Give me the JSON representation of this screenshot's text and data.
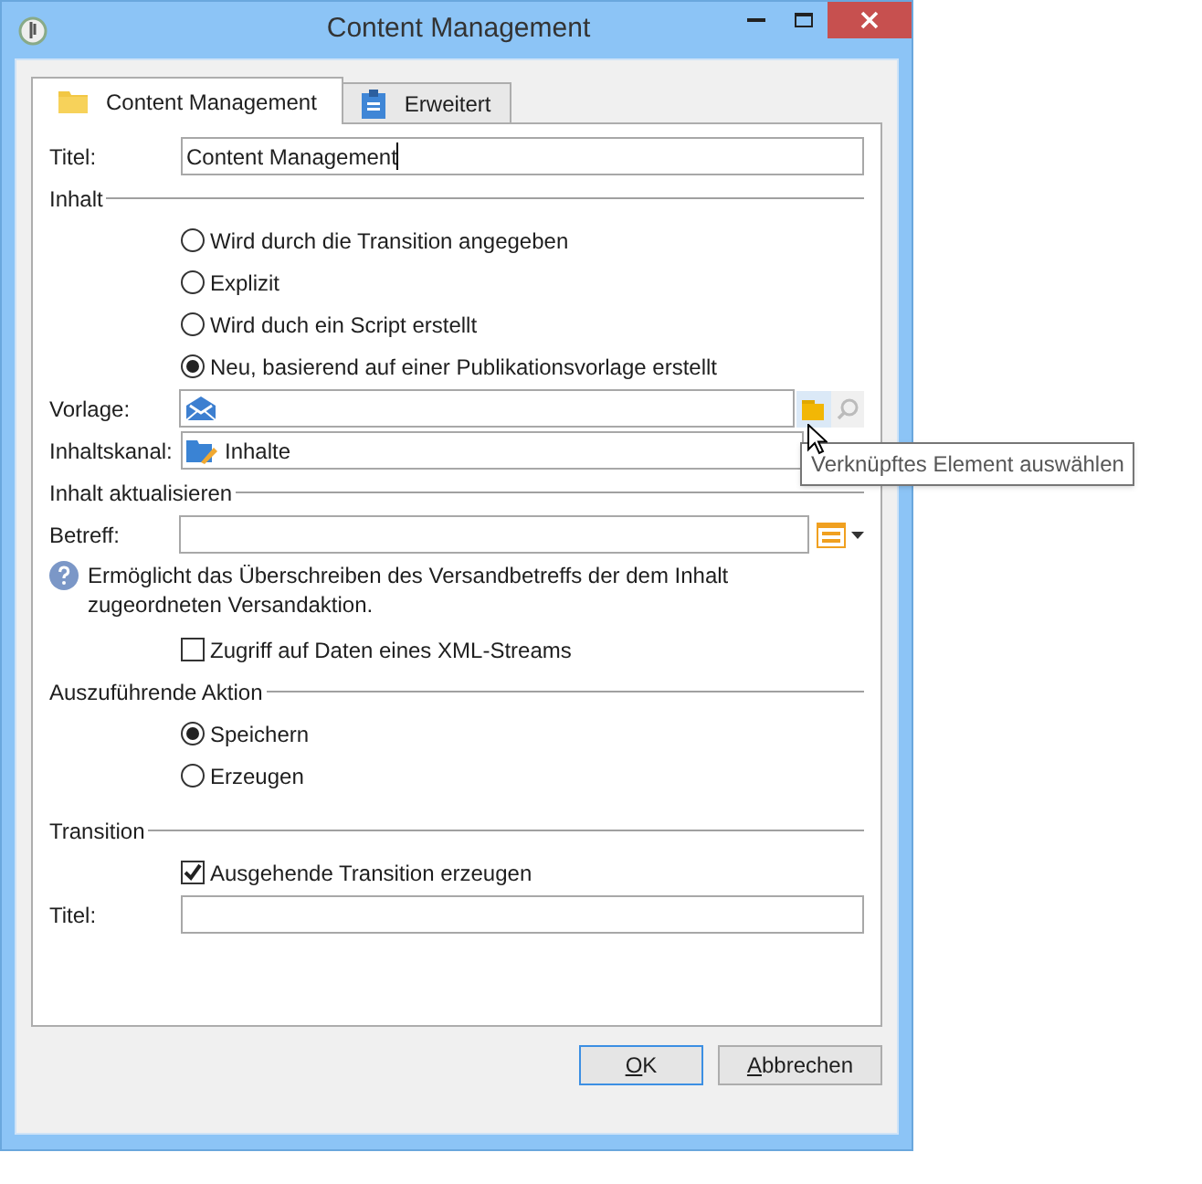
{
  "window": {
    "title": "Content Management"
  },
  "tabs": [
    {
      "label": "Content Management",
      "selected": true,
      "kind": "folder"
    },
    {
      "label": "Erweitert",
      "selected": false,
      "kind": "clipboard"
    }
  ],
  "title_field": {
    "label": "Titel:",
    "value": "Content Management"
  },
  "inhalt": {
    "heading": "Inhalt",
    "options": [
      {
        "label": "Wird durch die Transition angegeben",
        "selected": false
      },
      {
        "label": "Explizit",
        "selected": false
      },
      {
        "label": "Wird duch ein Script erstellt",
        "selected": false
      },
      {
        "label": "Neu, basierend auf einer Publikationsvorlage erstellt",
        "selected": true
      }
    ]
  },
  "vorlage": {
    "label": "Vorlage:"
  },
  "inhaltskanal": {
    "label": "Inhaltskanal:",
    "value": "Inhalte"
  },
  "tooltip": "Verknüpftes Element auswählen",
  "aktualisieren": {
    "heading": "Inhalt aktualisieren",
    "betreff_label": "Betreff:",
    "help": "Ermöglicht das Überschreiben des Versandbetreffs der dem Inhalt zugeordneten Versandaktion.",
    "xml": {
      "label": "Zugriff auf Daten eines XML-Streams",
      "checked": false
    }
  },
  "aktion": {
    "heading": "Auszuführende Aktion",
    "options": [
      {
        "label": "Speichern",
        "selected": true
      },
      {
        "label": "Erzeugen",
        "selected": false
      }
    ]
  },
  "transition": {
    "heading": "Transition",
    "checkbox": {
      "label": "Ausgehende Transition erzeugen",
      "checked": true
    },
    "title_label": "Titel:"
  },
  "buttons": [
    {
      "label": "OK",
      "default": true
    },
    {
      "label": "Abbrechen",
      "default": false
    }
  ]
}
